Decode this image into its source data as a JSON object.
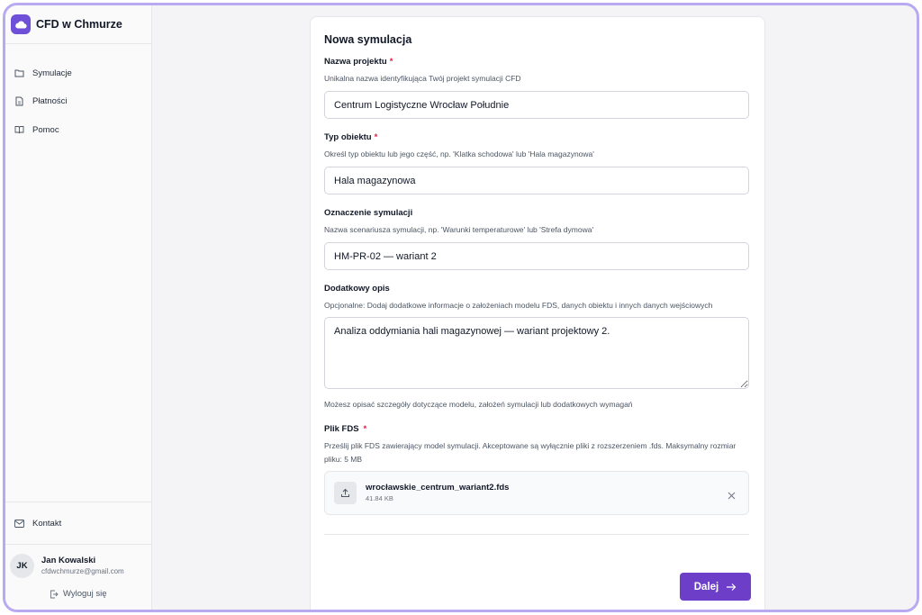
{
  "app": {
    "name": "CFD w Chmurze"
  },
  "sidebar": {
    "items": [
      {
        "label": "Symulacje",
        "icon": "folder-icon"
      },
      {
        "label": "Płatności",
        "icon": "document-icon"
      },
      {
        "label": "Pomoc",
        "icon": "book-icon"
      }
    ],
    "contact_label": "Kontakt",
    "user": {
      "initials": "JK",
      "name": "Jan Kowalski",
      "email": "cfdwchmurze@gmail.com"
    },
    "logout_label": "Wyloguj się"
  },
  "form": {
    "title": "Nowa symulacja",
    "project_name": {
      "label": "Nazwa projektu",
      "required": "*",
      "description": "Unikalna nazwa identyfikująca Twój projekt symulacji CFD",
      "value": "Centrum Logistyczne Wrocław Południe"
    },
    "object_type": {
      "label": "Typ obiektu",
      "required": "*",
      "description": "Określ typ obiektu lub jego część, np. 'Klatka schodowa' lub 'Hala magazynowa'",
      "value": "Hala magazynowa"
    },
    "simulation_id": {
      "label": "Oznaczenie symulacji",
      "description": "Nazwa scenariusza symulacji, np. 'Warunki temperaturowe' lub 'Strefa dymowa'",
      "value": "HM-PR-02 — wariant 2"
    },
    "extra_description": {
      "label": "Dodatkowy opis",
      "description": "Opcjonalne: Dodaj dodatkowe informacje o założeniach modelu FDS, danych obiektu i innych danych wejściowych",
      "value": "Analiza oddymiania hali magazynowej — wariant projektowy 2.",
      "helper": "Możesz opisać szczegóły dotyczące modelu, założeń symulacji lub dodatkowych wymagań"
    },
    "fds_file": {
      "label": "Plik FDS",
      "required": "*",
      "description": "Prześlij plik FDS zawierający model symulacji. Akceptowane są wyłącznie pliki z rozszerzeniem .fds. Maksymalny rozmiar pliku: 5 MB",
      "file_name": "wrocławskie_centrum_wariant2.fds",
      "file_size": "41.84 KB"
    },
    "next_label": "Dalej"
  },
  "colors": {
    "accent": "#6d3fc9",
    "frame_border": "#b9a9f0",
    "required": "#e11d48"
  }
}
